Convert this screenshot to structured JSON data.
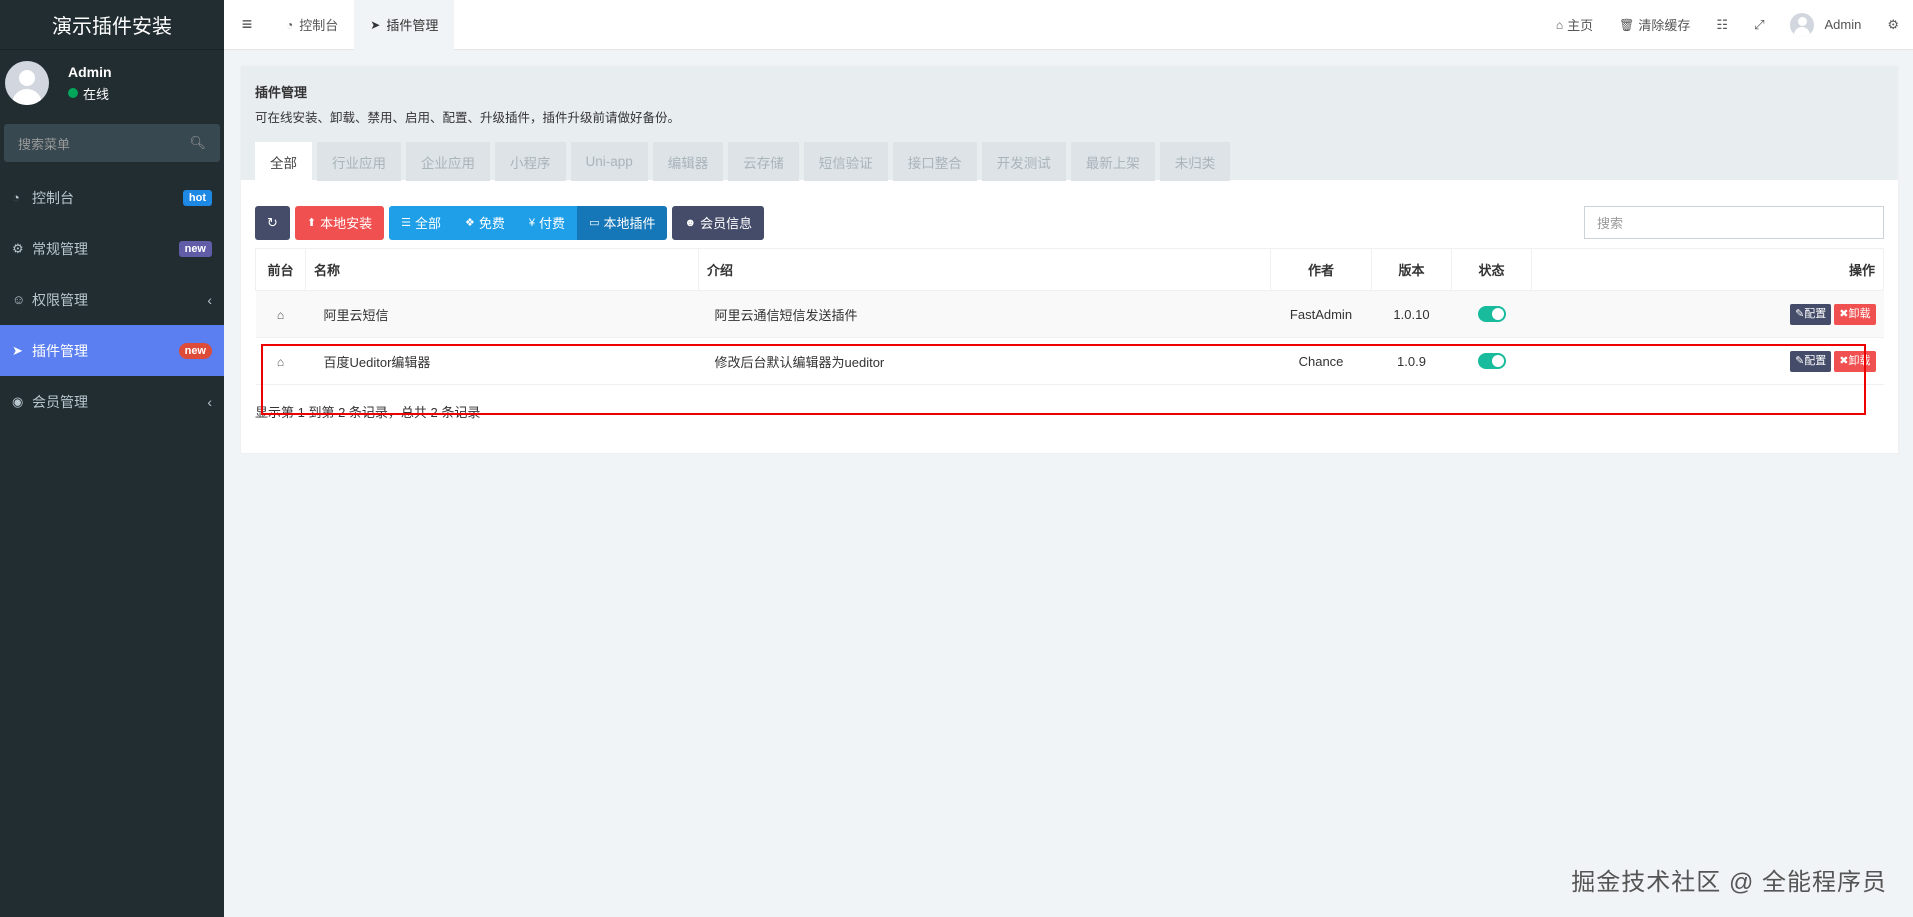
{
  "app": {
    "title": "演示插件安装"
  },
  "user": {
    "name": "Admin",
    "status": "在线"
  },
  "sidebar": {
    "search_placeholder": "搜索菜单",
    "items": [
      {
        "label": "控制台",
        "badge": "hot",
        "icon": "dashboard-icon"
      },
      {
        "label": "常规管理",
        "badge": "new",
        "icon": "cogs-icon"
      },
      {
        "label": "权限管理",
        "badge": "",
        "icon": "group-icon"
      },
      {
        "label": "插件管理",
        "badge": "new",
        "icon": "rocket-icon"
      },
      {
        "label": "会员管理",
        "badge": "",
        "icon": "user-circle-icon"
      }
    ]
  },
  "topbar": {
    "tabs": [
      {
        "label": "控制台",
        "icon": "dashboard-icon"
      },
      {
        "label": "插件管理",
        "icon": "rocket-icon"
      }
    ],
    "home": "主页",
    "clear_cache": "清除缓存",
    "username": "Admin"
  },
  "panel": {
    "title": "插件管理",
    "description": "可在线安装、卸载、禁用、启用、配置、升级插件，插件升级前请做好备份。",
    "tabs": [
      "全部",
      "行业应用",
      "企业应用",
      "小程序",
      "Uni-app",
      "编辑器",
      "云存储",
      "短信验证",
      "接口整合",
      "开发测试",
      "最新上架",
      "未归类"
    ]
  },
  "toolbar": {
    "local_install": "本地安装",
    "filter_all": "全部",
    "filter_free": "免费",
    "filter_paid": "付费",
    "filter_local": "本地插件",
    "member_info": "会员信息",
    "search_placeholder": "搜索"
  },
  "table": {
    "headers": {
      "frontend": "前台",
      "name": "名称",
      "intro": "介绍",
      "author": "作者",
      "version": "版本",
      "status": "状态",
      "actions": "操作"
    },
    "rows": [
      {
        "name": "阿里云短信",
        "intro": "阿里云通信短信发送插件",
        "author": "FastAdmin",
        "version": "1.0.10",
        "enabled": true
      },
      {
        "name": "百度Ueditor编辑器",
        "intro": "修改后台默认编辑器为ueditor",
        "author": "Chance",
        "version": "1.0.9",
        "enabled": true
      }
    ],
    "config_label": "配置",
    "uninstall_label": "卸载"
  },
  "pager": {
    "summary": "显示第 1 到第 2 条记录，总共 2 条记录"
  },
  "watermark": "掘金技术社区 @ 全能程序员",
  "colors": {
    "sidebar_bg": "#222d32",
    "active_menu": "#5b7ff0",
    "toggle_on": "#18bc9c",
    "danger": "#f05050",
    "dark_btn": "#444c69",
    "highlight": "#ee0000"
  }
}
